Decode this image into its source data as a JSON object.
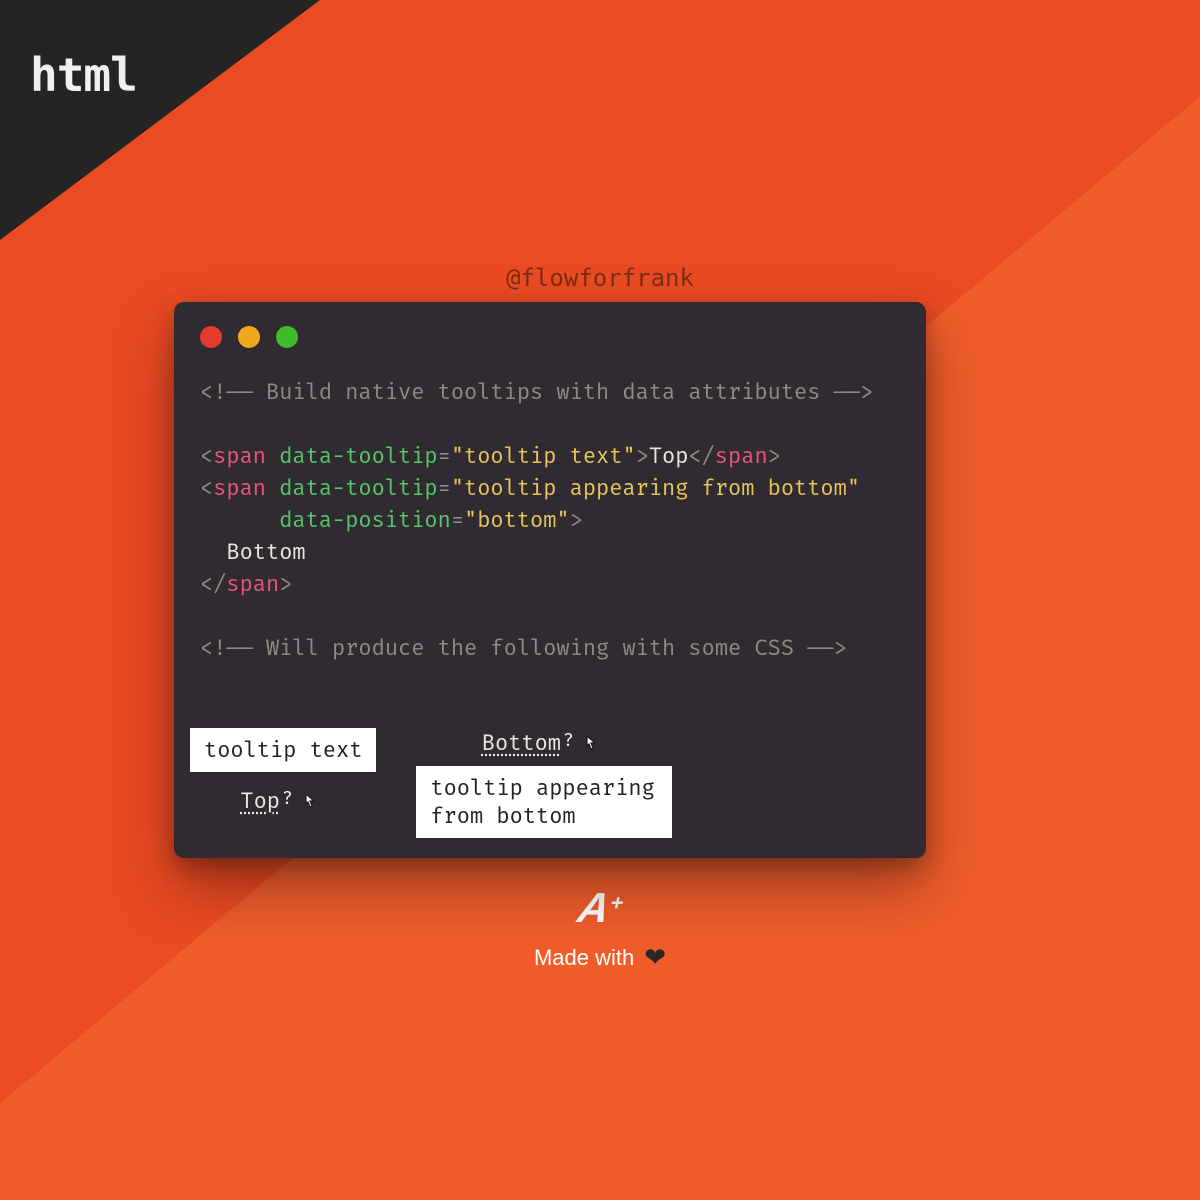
{
  "corner_label": "html",
  "handle": "@flowforfrank",
  "code": {
    "comment1": "Build native tooltips with data attributes",
    "tag": "span",
    "attr_tooltip": "data-tooltip",
    "attr_position": "data-position",
    "val_top_tooltip": "tooltip text",
    "val_top_text": "Top",
    "val_bottom_tooltip": "tooltip appearing from bottom",
    "val_bottom_position": "bottom",
    "val_bottom_text": "Bottom",
    "comment2": "Will produce the following with some CSS"
  },
  "preview": {
    "top_tooltip": "tooltip text",
    "top_label": "Top",
    "bottom_label": "Bottom",
    "bottom_tooltip": "tooltip appearing\nfrom bottom",
    "cursor_hint": "?"
  },
  "footer": {
    "logo_text": "A",
    "logo_plus": "+",
    "made_with": "Made with"
  }
}
